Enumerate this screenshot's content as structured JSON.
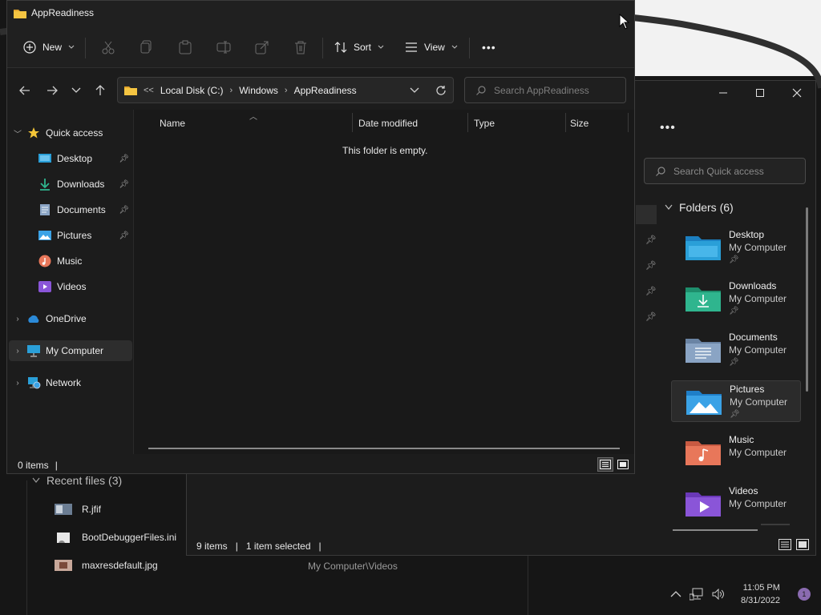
{
  "front_window": {
    "title": "AppReadiness",
    "toolbar": {
      "new_label": "New",
      "sort_label": "Sort",
      "view_label": "View",
      "more_label": "•••"
    },
    "address": {
      "overflow": "<<",
      "crumbs": [
        "Local Disk (C:)",
        "Windows",
        "AppReadiness"
      ]
    },
    "search_placeholder": "Search AppReadiness",
    "sidebar": {
      "quick_access": "Quick access",
      "items": [
        {
          "label": "Desktop",
          "pinned": true,
          "icon": "desktop-icon"
        },
        {
          "label": "Downloads",
          "pinned": true,
          "icon": "downloads-icon"
        },
        {
          "label": "Documents",
          "pinned": true,
          "icon": "documents-icon"
        },
        {
          "label": "Pictures",
          "pinned": true,
          "icon": "pictures-icon"
        },
        {
          "label": "Music",
          "pinned": false,
          "icon": "music-icon"
        },
        {
          "label": "Videos",
          "pinned": false,
          "icon": "videos-icon"
        }
      ],
      "onedrive": "OneDrive",
      "my_computer": "My Computer",
      "network": "Network"
    },
    "columns": {
      "name": "Name",
      "date_modified": "Date modified",
      "type": "Type",
      "size": "Size"
    },
    "empty_message": "This folder is empty.",
    "status": {
      "items": "0 items",
      "sep": "|"
    }
  },
  "back_window": {
    "toolbar_more": "•••",
    "search_placeholder": "Search Quick access",
    "folders_header": "Folders (6)",
    "folders": [
      {
        "name": "Desktop",
        "location": "My Computer",
        "pinned": true,
        "selected": false,
        "color": "#2a9fd8"
      },
      {
        "name": "Downloads",
        "location": "My Computer",
        "pinned": true,
        "selected": false,
        "color": "#2fb58e"
      },
      {
        "name": "Documents",
        "location": "My Computer",
        "pinned": true,
        "selected": false,
        "color": "#8aa4c4"
      },
      {
        "name": "Pictures",
        "location": "My Computer",
        "pinned": true,
        "selected": true,
        "color": "#3aa2e6"
      },
      {
        "name": "Music",
        "location": "My Computer",
        "pinned": false,
        "selected": false,
        "color": "#e8775a"
      },
      {
        "name": "Videos",
        "location": "My Computer",
        "pinned": false,
        "selected": false,
        "color": "#8a55d8"
      }
    ],
    "recent_header": "Recent files (3)",
    "recent_files": [
      {
        "name": "R.jfif"
      },
      {
        "name": "BootDebuggerFiles.ini"
      },
      {
        "name": "maxresdefault.jpg"
      }
    ],
    "recent_path": "My Computer\\Videos",
    "status": {
      "items": "9 items",
      "selected": "1 item selected",
      "sep": "|"
    }
  },
  "tray": {
    "time": "11:05 PM",
    "date": "8/31/2022",
    "notifications": "1"
  }
}
